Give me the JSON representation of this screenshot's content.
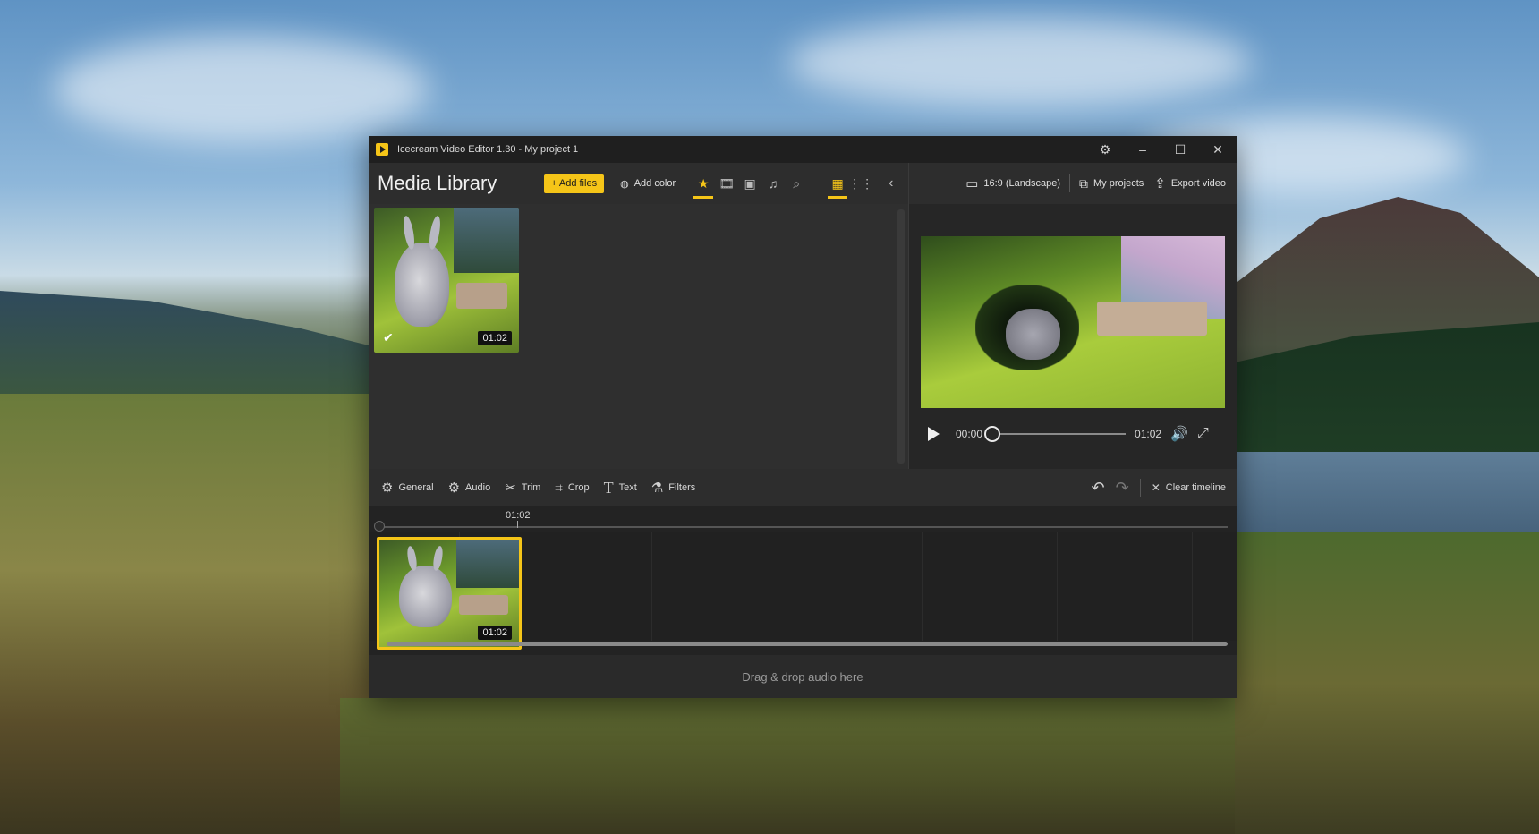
{
  "window": {
    "title": "Icecream Video Editor 1.30 - My project 1"
  },
  "titlebar": {
    "settings_icon": "gear-icon",
    "minimize_icon": "minimize-icon",
    "maximize_icon": "maximize-icon",
    "close_icon": "close-icon"
  },
  "library": {
    "title": "Media Library",
    "add_files_label": "+ Add files",
    "add_color_label": "Add color",
    "filters": [
      "star-icon",
      "film-icon",
      "image-icon",
      "music-icon",
      "search-icon"
    ],
    "views": [
      "grid-large-icon",
      "grid-small-icon"
    ],
    "items": [
      {
        "duration": "01:02",
        "selected": true
      }
    ]
  },
  "right_header": {
    "aspect_label": "16:9 (Landscape)",
    "projects_label": "My projects",
    "export_label": "Export video"
  },
  "player": {
    "current_time": "00:00",
    "total_time": "01:02",
    "progress": 0
  },
  "edit_tools": {
    "general": "General",
    "audio": "Audio",
    "trim": "Trim",
    "crop": "Crop",
    "text": "Text",
    "filters": "Filters",
    "clear_timeline": "Clear timeline"
  },
  "timeline": {
    "marker_label": "01:02",
    "clip_duration": "01:02"
  },
  "audio_drop": {
    "label": "Drag & drop audio here"
  },
  "colors": {
    "accent": "#f5c518",
    "panel": "#2d2d2d",
    "titlebar": "#1f1f1f"
  }
}
